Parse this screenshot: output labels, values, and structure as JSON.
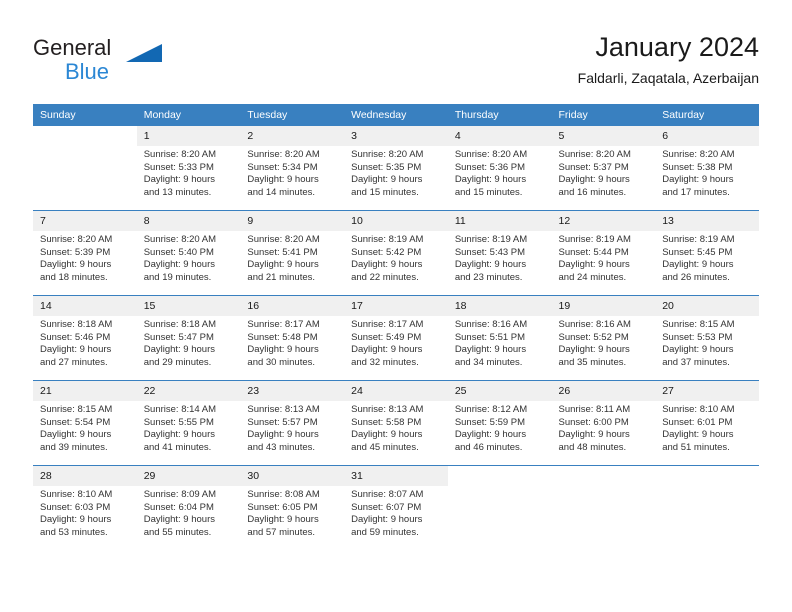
{
  "logo": {
    "word_one": "General",
    "word_two": "Blue",
    "triangle_color": "#1268b3",
    "blue_color": "#2b87d4"
  },
  "header": {
    "title": "January 2024",
    "subtitle": "Faldarli, Zaqatala, Azerbaijan"
  },
  "theme": {
    "header_bg": "#3980c0",
    "daynum_bg": "#f0f0f0",
    "rule_color": "#3980c0"
  },
  "calendar": {
    "weekdays": [
      "Sunday",
      "Monday",
      "Tuesday",
      "Wednesday",
      "Thursday",
      "Friday",
      "Saturday"
    ],
    "weeks": [
      [
        {
          "day": "",
          "kind": "blank",
          "sunrise": "",
          "sunset": "",
          "daylight_line1": "",
          "daylight_line2": ""
        },
        {
          "day": "1",
          "kind": "filled",
          "sunrise": "Sunrise: 8:20 AM",
          "sunset": "Sunset: 5:33 PM",
          "daylight_line1": "Daylight: 9 hours",
          "daylight_line2": "and 13 minutes."
        },
        {
          "day": "2",
          "kind": "filled",
          "sunrise": "Sunrise: 8:20 AM",
          "sunset": "Sunset: 5:34 PM",
          "daylight_line1": "Daylight: 9 hours",
          "daylight_line2": "and 14 minutes."
        },
        {
          "day": "3",
          "kind": "filled",
          "sunrise": "Sunrise: 8:20 AM",
          "sunset": "Sunset: 5:35 PM",
          "daylight_line1": "Daylight: 9 hours",
          "daylight_line2": "and 15 minutes."
        },
        {
          "day": "4",
          "kind": "filled",
          "sunrise": "Sunrise: 8:20 AM",
          "sunset": "Sunset: 5:36 PM",
          "daylight_line1": "Daylight: 9 hours",
          "daylight_line2": "and 15 minutes."
        },
        {
          "day": "5",
          "kind": "filled",
          "sunrise": "Sunrise: 8:20 AM",
          "sunset": "Sunset: 5:37 PM",
          "daylight_line1": "Daylight: 9 hours",
          "daylight_line2": "and 16 minutes."
        },
        {
          "day": "6",
          "kind": "filled",
          "sunrise": "Sunrise: 8:20 AM",
          "sunset": "Sunset: 5:38 PM",
          "daylight_line1": "Daylight: 9 hours",
          "daylight_line2": "and 17 minutes."
        }
      ],
      [
        {
          "day": "7",
          "kind": "filled",
          "sunrise": "Sunrise: 8:20 AM",
          "sunset": "Sunset: 5:39 PM",
          "daylight_line1": "Daylight: 9 hours",
          "daylight_line2": "and 18 minutes."
        },
        {
          "day": "8",
          "kind": "filled",
          "sunrise": "Sunrise: 8:20 AM",
          "sunset": "Sunset: 5:40 PM",
          "daylight_line1": "Daylight: 9 hours",
          "daylight_line2": "and 19 minutes."
        },
        {
          "day": "9",
          "kind": "filled",
          "sunrise": "Sunrise: 8:20 AM",
          "sunset": "Sunset: 5:41 PM",
          "daylight_line1": "Daylight: 9 hours",
          "daylight_line2": "and 21 minutes."
        },
        {
          "day": "10",
          "kind": "filled",
          "sunrise": "Sunrise: 8:19 AM",
          "sunset": "Sunset: 5:42 PM",
          "daylight_line1": "Daylight: 9 hours",
          "daylight_line2": "and 22 minutes."
        },
        {
          "day": "11",
          "kind": "filled",
          "sunrise": "Sunrise: 8:19 AM",
          "sunset": "Sunset: 5:43 PM",
          "daylight_line1": "Daylight: 9 hours",
          "daylight_line2": "and 23 minutes."
        },
        {
          "day": "12",
          "kind": "filled",
          "sunrise": "Sunrise: 8:19 AM",
          "sunset": "Sunset: 5:44 PM",
          "daylight_line1": "Daylight: 9 hours",
          "daylight_line2": "and 24 minutes."
        },
        {
          "day": "13",
          "kind": "filled",
          "sunrise": "Sunrise: 8:19 AM",
          "sunset": "Sunset: 5:45 PM",
          "daylight_line1": "Daylight: 9 hours",
          "daylight_line2": "and 26 minutes."
        }
      ],
      [
        {
          "day": "14",
          "kind": "filled",
          "sunrise": "Sunrise: 8:18 AM",
          "sunset": "Sunset: 5:46 PM",
          "daylight_line1": "Daylight: 9 hours",
          "daylight_line2": "and 27 minutes."
        },
        {
          "day": "15",
          "kind": "filled",
          "sunrise": "Sunrise: 8:18 AM",
          "sunset": "Sunset: 5:47 PM",
          "daylight_line1": "Daylight: 9 hours",
          "daylight_line2": "and 29 minutes."
        },
        {
          "day": "16",
          "kind": "filled",
          "sunrise": "Sunrise: 8:17 AM",
          "sunset": "Sunset: 5:48 PM",
          "daylight_line1": "Daylight: 9 hours",
          "daylight_line2": "and 30 minutes."
        },
        {
          "day": "17",
          "kind": "filled",
          "sunrise": "Sunrise: 8:17 AM",
          "sunset": "Sunset: 5:49 PM",
          "daylight_line1": "Daylight: 9 hours",
          "daylight_line2": "and 32 minutes."
        },
        {
          "day": "18",
          "kind": "filled",
          "sunrise": "Sunrise: 8:16 AM",
          "sunset": "Sunset: 5:51 PM",
          "daylight_line1": "Daylight: 9 hours",
          "daylight_line2": "and 34 minutes."
        },
        {
          "day": "19",
          "kind": "filled",
          "sunrise": "Sunrise: 8:16 AM",
          "sunset": "Sunset: 5:52 PM",
          "daylight_line1": "Daylight: 9 hours",
          "daylight_line2": "and 35 minutes."
        },
        {
          "day": "20",
          "kind": "filled",
          "sunrise": "Sunrise: 8:15 AM",
          "sunset": "Sunset: 5:53 PM",
          "daylight_line1": "Daylight: 9 hours",
          "daylight_line2": "and 37 minutes."
        }
      ],
      [
        {
          "day": "21",
          "kind": "filled",
          "sunrise": "Sunrise: 8:15 AM",
          "sunset": "Sunset: 5:54 PM",
          "daylight_line1": "Daylight: 9 hours",
          "daylight_line2": "and 39 minutes."
        },
        {
          "day": "22",
          "kind": "filled",
          "sunrise": "Sunrise: 8:14 AM",
          "sunset": "Sunset: 5:55 PM",
          "daylight_line1": "Daylight: 9 hours",
          "daylight_line2": "and 41 minutes."
        },
        {
          "day": "23",
          "kind": "filled",
          "sunrise": "Sunrise: 8:13 AM",
          "sunset": "Sunset: 5:57 PM",
          "daylight_line1": "Daylight: 9 hours",
          "daylight_line2": "and 43 minutes."
        },
        {
          "day": "24",
          "kind": "filled",
          "sunrise": "Sunrise: 8:13 AM",
          "sunset": "Sunset: 5:58 PM",
          "daylight_line1": "Daylight: 9 hours",
          "daylight_line2": "and 45 minutes."
        },
        {
          "day": "25",
          "kind": "filled",
          "sunrise": "Sunrise: 8:12 AM",
          "sunset": "Sunset: 5:59 PM",
          "daylight_line1": "Daylight: 9 hours",
          "daylight_line2": "and 46 minutes."
        },
        {
          "day": "26",
          "kind": "filled",
          "sunrise": "Sunrise: 8:11 AM",
          "sunset": "Sunset: 6:00 PM",
          "daylight_line1": "Daylight: 9 hours",
          "daylight_line2": "and 48 minutes."
        },
        {
          "day": "27",
          "kind": "filled",
          "sunrise": "Sunrise: 8:10 AM",
          "sunset": "Sunset: 6:01 PM",
          "daylight_line1": "Daylight: 9 hours",
          "daylight_line2": "and 51 minutes."
        }
      ],
      [
        {
          "day": "28",
          "kind": "filled",
          "sunrise": "Sunrise: 8:10 AM",
          "sunset": "Sunset: 6:03 PM",
          "daylight_line1": "Daylight: 9 hours",
          "daylight_line2": "and 53 minutes."
        },
        {
          "day": "29",
          "kind": "filled",
          "sunrise": "Sunrise: 8:09 AM",
          "sunset": "Sunset: 6:04 PM",
          "daylight_line1": "Daylight: 9 hours",
          "daylight_line2": "and 55 minutes."
        },
        {
          "day": "30",
          "kind": "filled",
          "sunrise": "Sunrise: 8:08 AM",
          "sunset": "Sunset: 6:05 PM",
          "daylight_line1": "Daylight: 9 hours",
          "daylight_line2": "and 57 minutes."
        },
        {
          "day": "31",
          "kind": "filled",
          "sunrise": "Sunrise: 8:07 AM",
          "sunset": "Sunset: 6:07 PM",
          "daylight_line1": "Daylight: 9 hours",
          "daylight_line2": "and 59 minutes."
        },
        {
          "day": "",
          "kind": "blank",
          "sunrise": "",
          "sunset": "",
          "daylight_line1": "",
          "daylight_line2": ""
        },
        {
          "day": "",
          "kind": "blank",
          "sunrise": "",
          "sunset": "",
          "daylight_line1": "",
          "daylight_line2": ""
        },
        {
          "day": "",
          "kind": "blank",
          "sunrise": "",
          "sunset": "",
          "daylight_line1": "",
          "daylight_line2": ""
        }
      ]
    ]
  }
}
